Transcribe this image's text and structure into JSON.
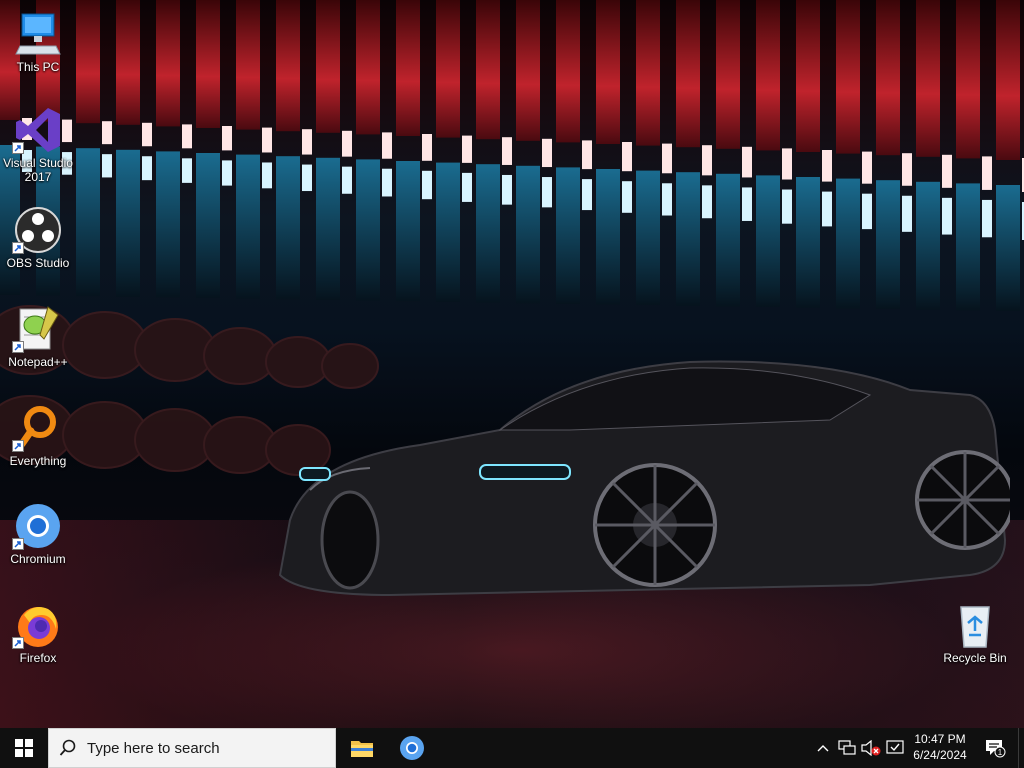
{
  "desktop": {
    "icons": [
      {
        "label": "This PC",
        "icon": "computer-icon"
      },
      {
        "label": "Visual Studio 2017",
        "icon": "visual-studio-icon"
      },
      {
        "label": "OBS Studio",
        "icon": "obs-icon"
      },
      {
        "label": "Notepad++",
        "icon": "notepadpp-icon"
      },
      {
        "label": "Everything",
        "icon": "everything-search-icon"
      },
      {
        "label": "Chromium",
        "icon": "chromium-icon"
      },
      {
        "label": "Firefox",
        "icon": "firefox-icon"
      },
      {
        "label": "Recycle Bin",
        "icon": "recycle-bin-icon"
      }
    ]
  },
  "taskbar": {
    "search_placeholder": "Type here to search",
    "pinned": [
      {
        "name": "File Explorer",
        "icon": "file-explorer-icon"
      },
      {
        "name": "Chromium",
        "icon": "chromium-icon"
      }
    ],
    "tray": {
      "icons": [
        "chevron-up-icon",
        "network-icon",
        "volume-muted-icon",
        "action-center-icon"
      ]
    },
    "clock": {
      "time": "10:47 PM",
      "date": "6/24/2024"
    },
    "notifications": {
      "count": "1"
    }
  },
  "colors": {
    "taskbar_bg": "#101010",
    "search_bg": "#f3f3f3",
    "windows_blue": "#0a84d8"
  }
}
